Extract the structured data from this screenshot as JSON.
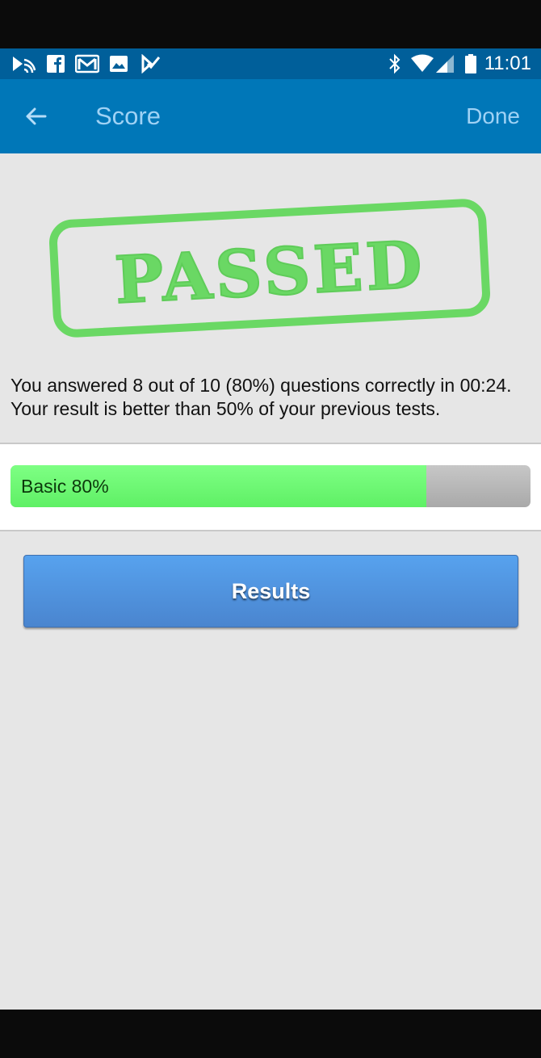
{
  "status_bar": {
    "time": "11:01",
    "notification_icons": [
      "cast-icon",
      "facebook-icon",
      "gmail-icon",
      "image-icon",
      "check-app-icon"
    ],
    "system_icons": [
      "bluetooth-icon",
      "wifi-icon",
      "signal-icon",
      "battery-icon"
    ]
  },
  "app_bar": {
    "title": "Score",
    "done_label": "Done",
    "back_icon": "arrow-left-icon"
  },
  "stamp": {
    "text": "PASSED",
    "color": "#6ad864"
  },
  "summary": {
    "message": "You answered 8 out of 10 (80%) questions correctly in 00:24. Your result is better than 50% of your previous tests."
  },
  "progress": {
    "label": "Basic 80%",
    "fraction": 0.8,
    "fill_color": "#6cf771",
    "track_color": "#b4b4b4"
  },
  "actions": {
    "results_label": "Results"
  },
  "colors": {
    "status_bar": "#005f9a",
    "app_bar": "#0077b8",
    "accent_text": "#9fd2f5",
    "background": "#e6e6e6",
    "button": "#4f90dd"
  }
}
